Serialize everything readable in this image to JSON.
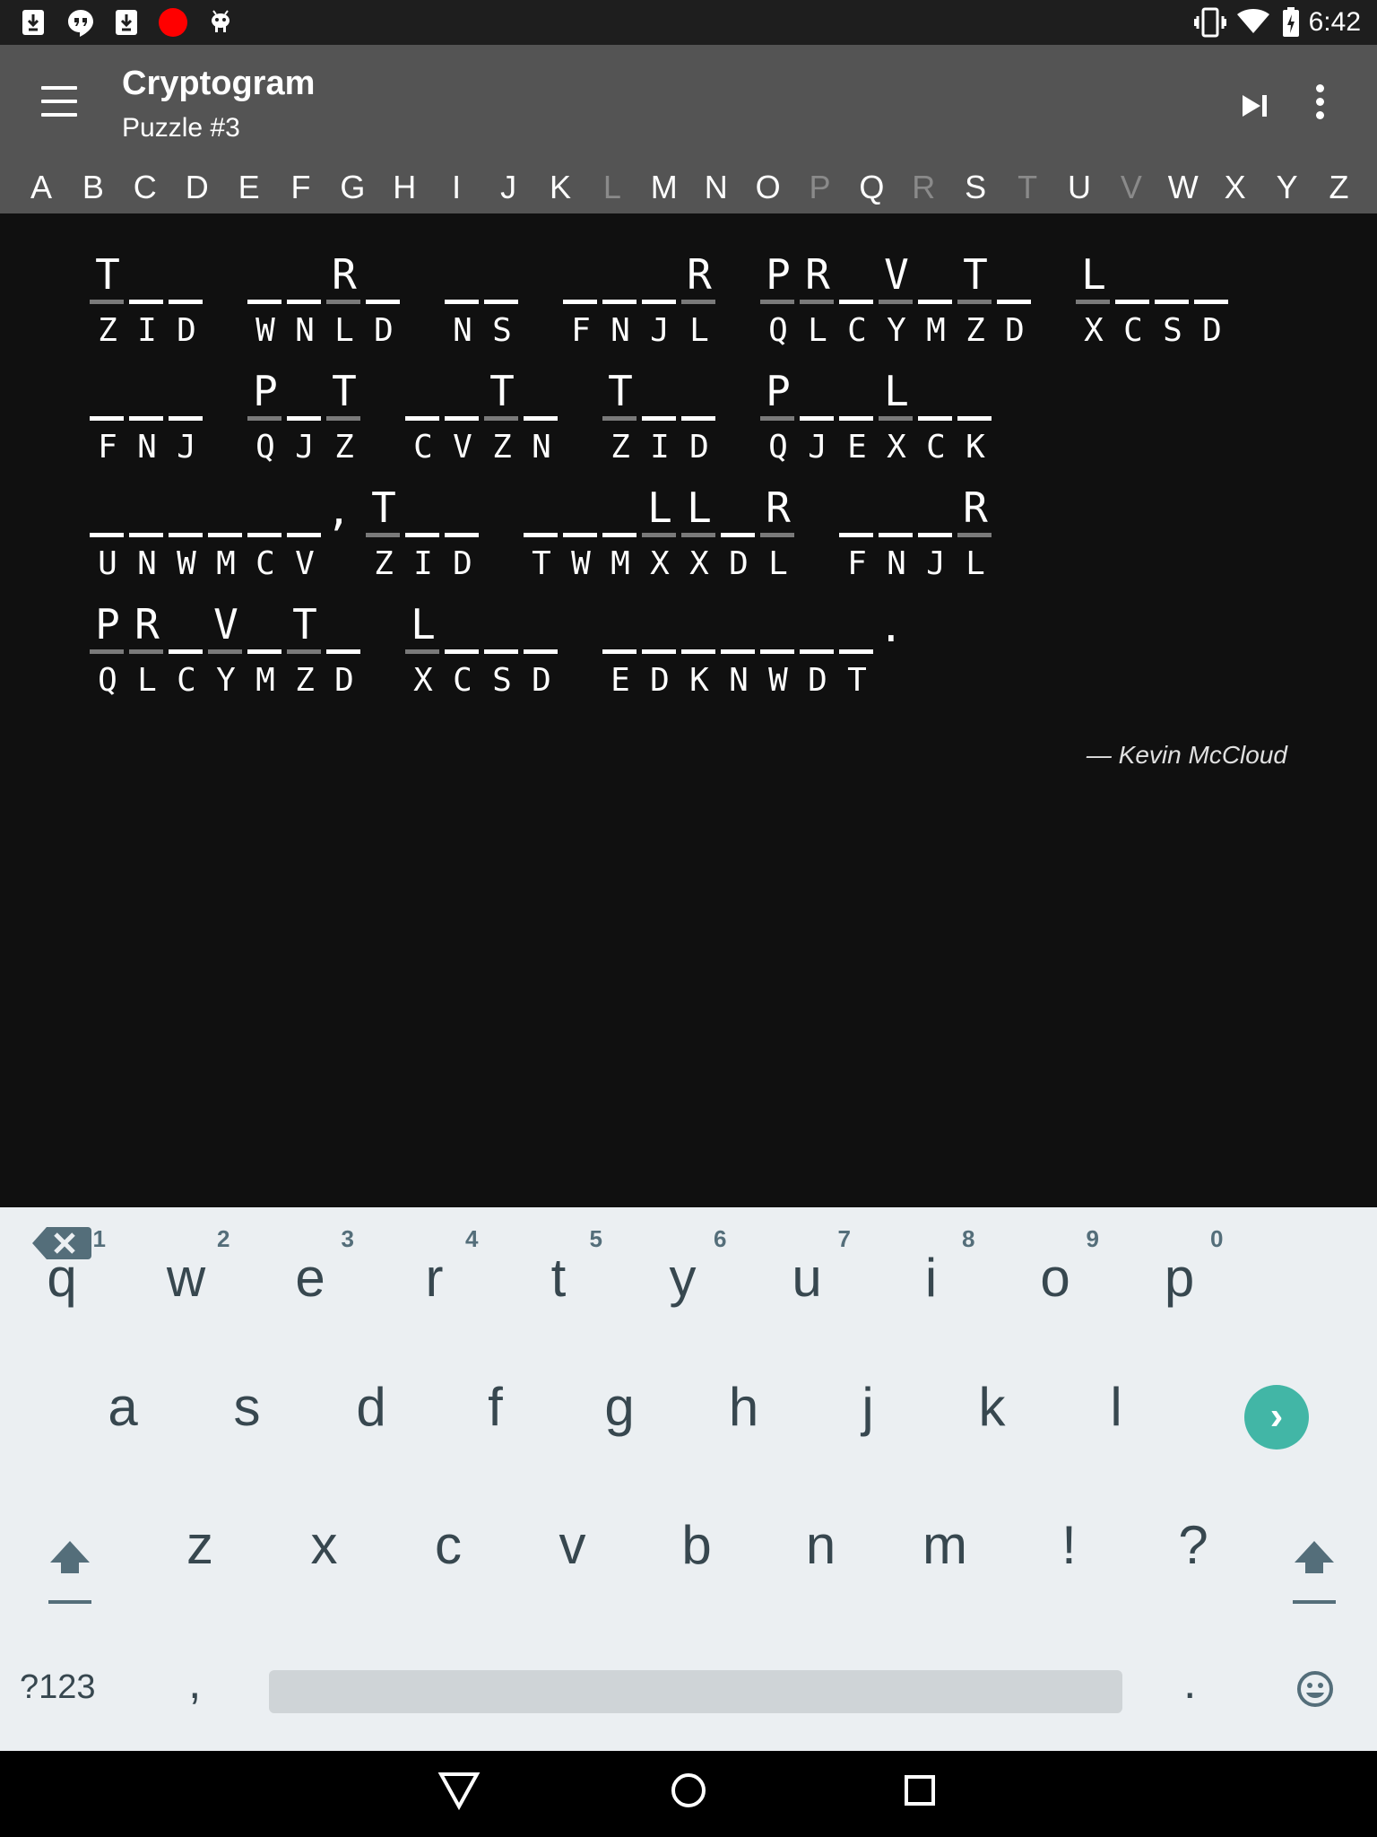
{
  "status_bar": {
    "time": "6:42",
    "left_icons": [
      "download-icon",
      "hangouts-icon",
      "download-icon",
      "record-icon",
      "android-icon"
    ],
    "right_icons": [
      "vibrate-icon",
      "wifi-icon",
      "battery-icon"
    ]
  },
  "app_bar": {
    "title": "Cryptogram",
    "subtitle": "Puzzle #3"
  },
  "alphabet": [
    {
      "letter": "A",
      "used": false
    },
    {
      "letter": "B",
      "used": false
    },
    {
      "letter": "C",
      "used": false
    },
    {
      "letter": "D",
      "used": false
    },
    {
      "letter": "E",
      "used": false
    },
    {
      "letter": "F",
      "used": false
    },
    {
      "letter": "G",
      "used": false
    },
    {
      "letter": "H",
      "used": false
    },
    {
      "letter": "I",
      "used": false
    },
    {
      "letter": "J",
      "used": false
    },
    {
      "letter": "K",
      "used": false
    },
    {
      "letter": "L",
      "used": true
    },
    {
      "letter": "M",
      "used": false
    },
    {
      "letter": "N",
      "used": false
    },
    {
      "letter": "O",
      "used": false
    },
    {
      "letter": "P",
      "used": true
    },
    {
      "letter": "Q",
      "used": false
    },
    {
      "letter": "R",
      "used": true
    },
    {
      "letter": "S",
      "used": false
    },
    {
      "letter": "T",
      "used": true
    },
    {
      "letter": "U",
      "used": false
    },
    {
      "letter": "V",
      "used": true
    },
    {
      "letter": "W",
      "used": false
    },
    {
      "letter": "X",
      "used": false
    },
    {
      "letter": "Y",
      "used": false
    },
    {
      "letter": "Z",
      "used": false
    }
  ],
  "puzzle": {
    "lines": [
      [
        {
          "cipher": "ZID",
          "plain": "T  "
        },
        {
          "cipher": "WNLD",
          "plain": "  R "
        },
        {
          "cipher": "NS",
          "plain": "  "
        },
        {
          "cipher": "FNJL",
          "plain": "   R"
        },
        {
          "cipher": "QLCYMZD",
          "plain": "PR V T "
        },
        {
          "cipher": "XCSD",
          "plain": "L   "
        }
      ],
      [
        {
          "cipher": "FNJ",
          "plain": "   "
        },
        {
          "cipher": "QJZ",
          "plain": "P T"
        },
        {
          "cipher": "CVZN",
          "plain": "  T "
        },
        {
          "cipher": "ZID",
          "plain": "T  "
        },
        {
          "cipher": "QJEXCK",
          "plain": "P  L  "
        }
      ],
      [
        {
          "cipher": "UNWMCV",
          "plain": "      ",
          "trailing": ","
        },
        {
          "cipher": "ZID",
          "plain": "T  "
        },
        {
          "cipher": "TWMXXDL",
          "plain": "   LL R"
        },
        {
          "cipher": "FNJL",
          "plain": "   R"
        }
      ],
      [
        {
          "cipher": "QLCYMZD",
          "plain": "PR V T "
        },
        {
          "cipher": "XCSD",
          "plain": "L   "
        },
        {
          "cipher": "EDKNWDT",
          "plain": "       ",
          "trailing": "."
        }
      ]
    ],
    "author": "— Kevin McCloud"
  },
  "keyboard": {
    "row1": [
      {
        "key": "q",
        "hint": "1"
      },
      {
        "key": "w",
        "hint": "2"
      },
      {
        "key": "e",
        "hint": "3"
      },
      {
        "key": "r",
        "hint": "4"
      },
      {
        "key": "t",
        "hint": "5"
      },
      {
        "key": "y",
        "hint": "6"
      },
      {
        "key": "u",
        "hint": "7"
      },
      {
        "key": "i",
        "hint": "8"
      },
      {
        "key": "o",
        "hint": "9"
      },
      {
        "key": "p",
        "hint": "0"
      }
    ],
    "row2": [
      "a",
      "s",
      "d",
      "f",
      "g",
      "h",
      "j",
      "k",
      "l"
    ],
    "row3": [
      "z",
      "x",
      "c",
      "v",
      "b",
      "n",
      "m",
      "!",
      "?"
    ],
    "symbols_label": "?123",
    "comma": ",",
    "period": ".",
    "accent_color": "#42b6a6"
  },
  "nav_bar": {
    "icons": [
      "back-icon",
      "home-icon",
      "recents-icon"
    ]
  }
}
